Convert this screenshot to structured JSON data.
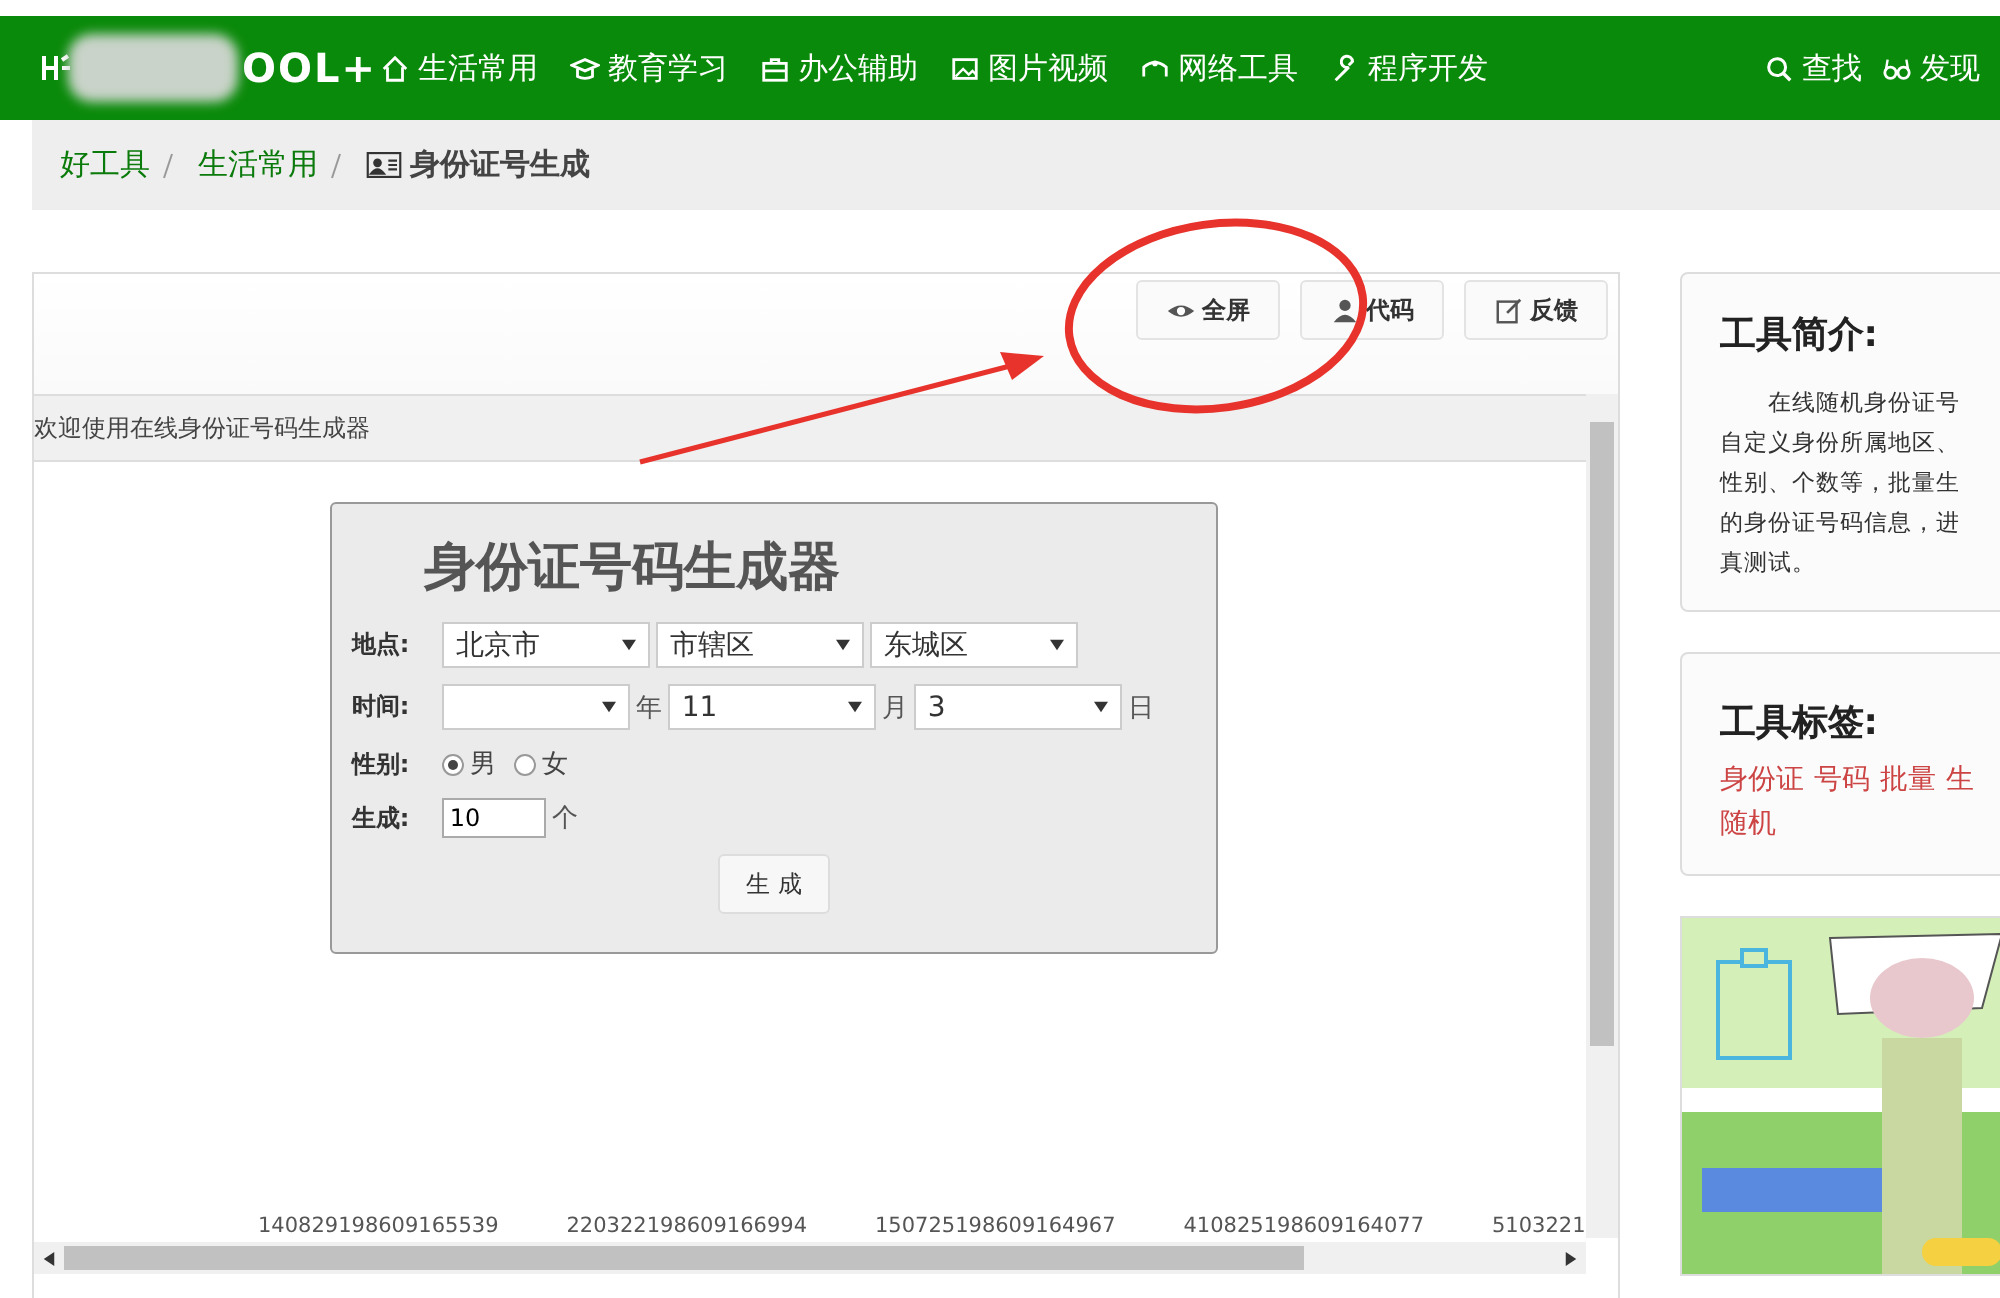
{
  "nav": {
    "logo_text": "OOL+",
    "items": [
      {
        "label": "生活常用"
      },
      {
        "label": "教育学习"
      },
      {
        "label": "办公辅助"
      },
      {
        "label": "图片视频"
      },
      {
        "label": "网络工具"
      },
      {
        "label": "程序开发"
      }
    ],
    "right_items": [
      {
        "label": "查找"
      },
      {
        "label": "发现"
      }
    ]
  },
  "breadcrumb": [
    {
      "label": "好工具",
      "kind": "link"
    },
    {
      "label": "生活常用",
      "kind": "link"
    },
    {
      "label": "身份证号生成",
      "kind": "current"
    }
  ],
  "toolbar": [
    {
      "label": "全屏"
    },
    {
      "label": "代码"
    },
    {
      "label": "反馈"
    }
  ],
  "frame_title": "欢迎使用在线身份证号码生成器",
  "generator": {
    "title": "身份证号码生成器",
    "location": {
      "label": "地点:",
      "selects": [
        "北京市",
        "市辖区",
        "东城区"
      ]
    },
    "time": {
      "label": "时间:",
      "selects": [
        {
          "suffix": "年"
        },
        {
          "value": "11",
          "suffix": "月"
        },
        {
          "value": "3",
          "suffix": "日"
        }
      ]
    },
    "gender": {
      "label": "性别:",
      "options": [
        {
          "label": "男",
          "selected": true
        },
        {
          "label": "女",
          "selected": false
        }
      ]
    },
    "count": {
      "label": "生成:",
      "value": "10",
      "suffix": "个"
    },
    "button": "生 成"
  },
  "results": [
    "140829198609165539",
    "220322198609166994",
    "150725198609164967",
    "410825198609164077",
    "5103221"
  ],
  "sidebar": {
    "intro": {
      "title": "工具简介:",
      "lines": [
        "　　在线随机身份证号",
        "自定义身份所属地区、",
        "性别、个数等，批量生",
        "的身份证号码信息，进",
        "真测试。"
      ]
    },
    "tags": {
      "title": "工具标签:",
      "lines": [
        [
          "身份证",
          "号码",
          "批量",
          "生"
        ],
        [
          "随机"
        ]
      ]
    }
  }
}
